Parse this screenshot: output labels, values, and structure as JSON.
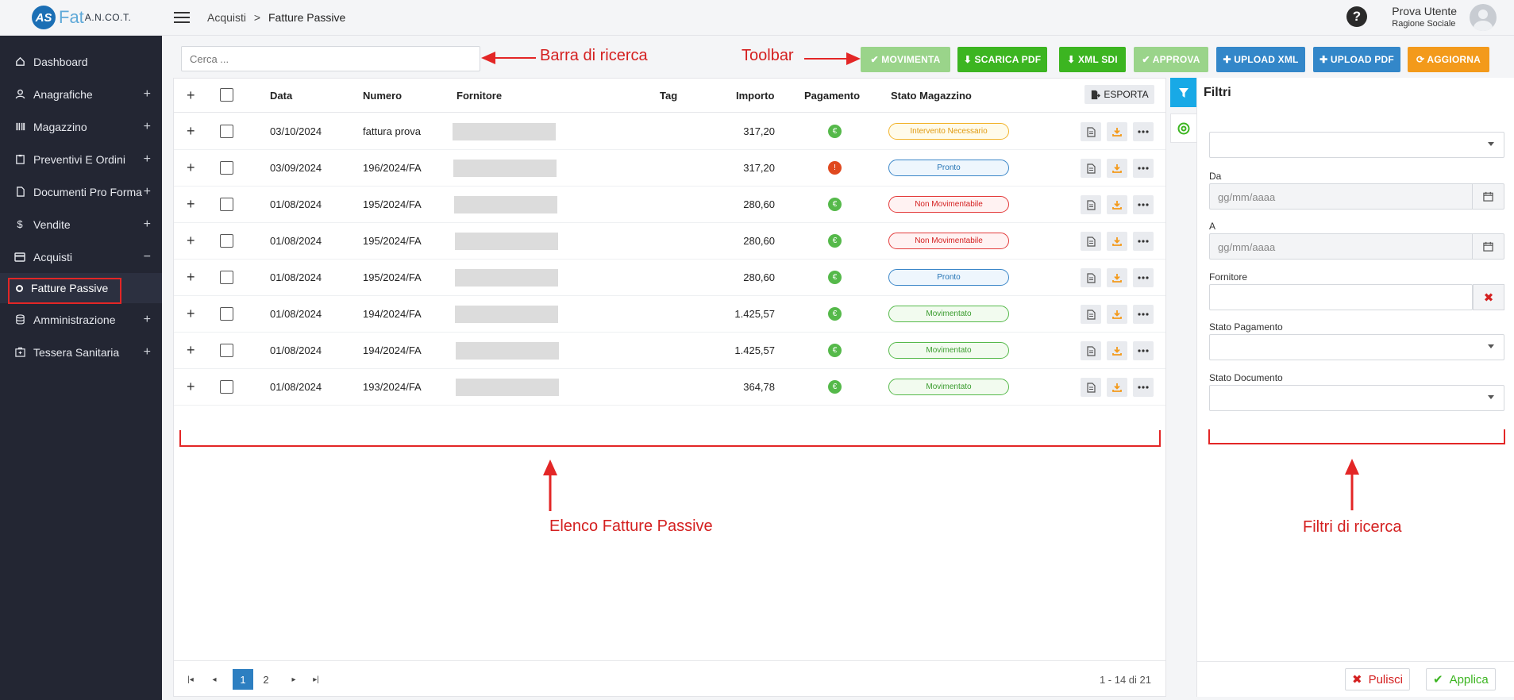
{
  "app": {
    "logo_badge": "AS",
    "logo_text": "Fat",
    "logo_sub": "A.N.CO.T."
  },
  "sidebar": {
    "items": [
      {
        "label": "Dashboard",
        "icon": "home-icon",
        "toggle": ""
      },
      {
        "label": "Anagrafiche",
        "icon": "user-icon",
        "toggle": "+"
      },
      {
        "label": "Magazzino",
        "icon": "barcode-icon",
        "toggle": "+"
      },
      {
        "label": "Preventivi E Ordini",
        "icon": "clipboard-icon",
        "toggle": "+"
      },
      {
        "label": "Documenti Pro Forma",
        "icon": "document-icon",
        "toggle": "+"
      },
      {
        "label": "Vendite",
        "icon": "dollar-icon",
        "toggle": "+"
      },
      {
        "label": "Acquisti",
        "icon": "credit-card-icon",
        "toggle": "−"
      }
    ],
    "sub_active": "Fatture Passive",
    "items_after": [
      {
        "label": "Amministrazione",
        "icon": "database-icon",
        "toggle": "+"
      },
      {
        "label": "Tessera Sanitaria",
        "icon": "medkit-icon",
        "toggle": "+"
      }
    ]
  },
  "topbar": {
    "breadcrumb_parent": "Acquisti",
    "breadcrumb_sep": ">",
    "breadcrumb_current": "Fatture Passive",
    "help": "?",
    "user_name": "Prova Utente",
    "user_role": "Ragione Sociale"
  },
  "search": {
    "placeholder": "Cerca ..."
  },
  "toolbar": {
    "movimenta": "✔ MOVIMENTA",
    "scarica_pdf": "⬇ SCARICA PDF",
    "xml_sdi": "⬇ XML SDI",
    "approva": "✔ APPROVA",
    "upload_xml": "✚ UPLOAD XML",
    "upload_pdf": "✚ UPLOAD PDF",
    "aggiorna": "⟳ AGGIORNA"
  },
  "annotations": {
    "search": "Barra di ricerca",
    "toolbar": "Toolbar",
    "list": "Elenco Fatture Passive",
    "filters": "Filtri di ricerca"
  },
  "table": {
    "headers": {
      "expand": "+",
      "data": "Data",
      "numero": "Numero",
      "fornitore": "Fornitore",
      "tag": "Tag",
      "importo": "Importo",
      "pagamento": "Pagamento",
      "stato": "Stato Magazzino",
      "esporta": "ESPORTA"
    },
    "rows": [
      {
        "data": "03/10/2024",
        "numero": "fattura prova",
        "importo": "317,20",
        "pagamento": "ok",
        "stato": "Intervento Necessario",
        "stato_class": "y"
      },
      {
        "data": "03/09/2024",
        "numero": "196/2024/FA",
        "importo": "317,20",
        "pagamento": "warn",
        "stato": "Pronto",
        "stato_class": "b"
      },
      {
        "data": "01/08/2024",
        "numero": "195/2024/FA",
        "importo": "280,60",
        "pagamento": "ok",
        "stato": "Non Movimentabile",
        "stato_class": "r"
      },
      {
        "data": "01/08/2024",
        "numero": "195/2024/FA",
        "importo": "280,60",
        "pagamento": "ok",
        "stato": "Non Movimentabile",
        "stato_class": "r"
      },
      {
        "data": "01/08/2024",
        "numero": "195/2024/FA",
        "importo": "280,60",
        "pagamento": "ok",
        "stato": "Pronto",
        "stato_class": "b"
      },
      {
        "data": "01/08/2024",
        "numero": "194/2024/FA",
        "importo": "1.425,57",
        "pagamento": "ok",
        "stato": "Movimentato",
        "stato_class": "g"
      },
      {
        "data": "01/08/2024",
        "numero": "194/2024/FA",
        "importo": "1.425,57",
        "pagamento": "ok",
        "stato": "Movimentato",
        "stato_class": "g"
      },
      {
        "data": "01/08/2024",
        "numero": "193/2024/FA",
        "importo": "364,78",
        "pagamento": "ok",
        "stato": "Movimentato",
        "stato_class": "g"
      }
    ],
    "pager": {
      "first": "|◂",
      "prev": "◂",
      "page1": "1",
      "page2": "2",
      "next": "▸",
      "last": "▸|",
      "summary": "1 - 14 di 21"
    }
  },
  "filters": {
    "title": "Filtri",
    "da_label": "Da",
    "da_placeholder": "gg/mm/aaaa",
    "a_label": "A",
    "a_placeholder": "gg/mm/aaaa",
    "fornitore_label": "Fornitore",
    "stato_pagamento_label": "Stato Pagamento",
    "stato_documento_label": "Stato Documento",
    "pulisci": "Pulisci",
    "applica": "Applica"
  },
  "colors": {
    "sidebar_bg": "#232633",
    "green": "#3cb521",
    "blue": "#3387c9",
    "orange": "#f39a1b",
    "annotation_red": "#e32626"
  }
}
